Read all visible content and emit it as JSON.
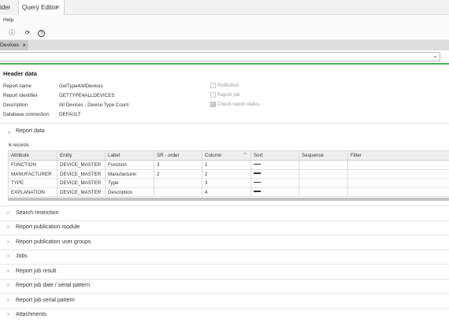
{
  "tabs": [
    {
      "label": "ider"
    },
    {
      "label": "Query Editor",
      "close": "×"
    }
  ],
  "menu": {
    "help": "Help"
  },
  "toolbar": {
    "info_glyph": "ⓘ",
    "refresh_glyph": "⟳",
    "help_glyph": "?"
  },
  "subtab": {
    "label": "Devices",
    "close": "×"
  },
  "dropdown": {
    "value": "",
    "chevron": "⌄"
  },
  "header": {
    "title": "Header data",
    "fields": [
      {
        "label": "Report name",
        "value": "GetType4AllDevices"
      },
      {
        "label": "Report identifier",
        "value": "GETTYPE4ALLDEVICES"
      },
      {
        "label": "Description",
        "value": "All Devices - Device Type Count"
      },
      {
        "label": "Database connection",
        "value": "DEFAULT"
      }
    ],
    "checks": [
      {
        "label": "Published",
        "checked": false
      },
      {
        "label": "Report job",
        "checked": false
      },
      {
        "label": "Check report status",
        "checked": true
      }
    ]
  },
  "report_data": {
    "title": "Report data",
    "records": "6 records",
    "columns": [
      "Attribute",
      "Entity",
      "Label",
      "SR - order",
      "Column",
      "Sort",
      "Sequence",
      "Filter"
    ],
    "rows": [
      [
        "FUNCTION",
        "DEVICE_MASTER",
        "Function",
        "3",
        "1",
        "—",
        "",
        ""
      ],
      [
        "MANUFACTURER",
        "DEVICE_MASTER",
        "Manufacturer",
        "2",
        "2",
        "—",
        "",
        ""
      ],
      [
        "TYPE",
        "DEVICE_MASTER",
        "Type",
        "",
        "3",
        "—",
        "",
        ""
      ],
      [
        "EXPLANATION",
        "DEVICE_MASTER",
        "Description",
        "",
        "4",
        "—",
        "",
        ""
      ]
    ]
  },
  "sections": [
    {
      "label": "Search restriction"
    },
    {
      "label": "Report publication module"
    },
    {
      "label": "Report publication user groups"
    },
    {
      "label": "Jobs"
    },
    {
      "label": "Report job result"
    },
    {
      "label": "Report job date / serial pattern"
    },
    {
      "label": "Report job serial pattern"
    },
    {
      "label": "Attachments"
    }
  ],
  "icons": {
    "collapsed": "chevron-right-icon",
    "expanded": "chevron-down-icon"
  },
  "colors": {
    "accent_line": "#4caf50",
    "tabbar": "#f2f2f2",
    "active_subtab": "#c8c8c8"
  }
}
